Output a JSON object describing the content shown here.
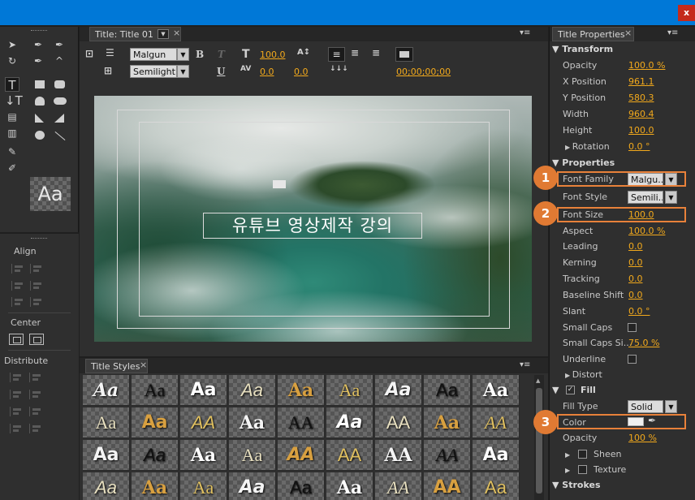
{
  "window": {
    "close_label": "x"
  },
  "title_panel": {
    "tab_label": "Title: Title 01",
    "font_family": "Malgun ...",
    "font_style": "Semilight",
    "bold_label": "B",
    "italic_label": "T",
    "underline_label": "U",
    "font_size": "100.0",
    "leading": "100.0",
    "kerning": "0.0",
    "tracking": "0.0",
    "timecode": "00;00;00;00",
    "canvas_text": "유튜브 영상제작 강의"
  },
  "styles_panel": {
    "tab_label": "Title Styles",
    "samples": [
      [
        "Aa",
        "Aa",
        "Aa",
        "Aa",
        "Aa",
        "Aa",
        "Aa",
        "Aa",
        "Aa"
      ],
      [
        "Aa",
        "Aa",
        "AA",
        "Aa",
        "AA",
        "Aa",
        "AA",
        "Aa",
        "AA"
      ],
      [
        "Aa",
        "Aa",
        "Aa",
        "Aa",
        "AA",
        "AA",
        "AA",
        "AA",
        "Aa"
      ],
      [
        "Aa",
        "Aa",
        "Aa",
        "Aa",
        "Aa",
        "Aa",
        "AA",
        "AA",
        "Aa"
      ]
    ]
  },
  "properties_panel": {
    "tab_label": "Title Properties",
    "transform_label": "Transform",
    "opacity": {
      "label": "Opacity",
      "value": "100.0 %"
    },
    "x_position": {
      "label": "X Position",
      "value": "961.1"
    },
    "y_position": {
      "label": "Y Position",
      "value": "580.3"
    },
    "width": {
      "label": "Width",
      "value": "960.4"
    },
    "height": {
      "label": "Height",
      "value": "100.0"
    },
    "rotation": {
      "label": "Rotation",
      "value": "0.0 °"
    },
    "properties_label": "Properties",
    "font_family": {
      "label": "Font Family",
      "value": "Malgu..."
    },
    "font_style": {
      "label": "Font Style",
      "value": "Semili..."
    },
    "font_size": {
      "label": "Font Size",
      "value": "100.0"
    },
    "aspect": {
      "label": "Aspect",
      "value": "100.0 %"
    },
    "leading": {
      "label": "Leading",
      "value": "0.0"
    },
    "kerning": {
      "label": "Kerning",
      "value": "0.0"
    },
    "tracking": {
      "label": "Tracking",
      "value": "0.0"
    },
    "baseline_shift": {
      "label": "Baseline Shift",
      "value": "0.0"
    },
    "slant": {
      "label": "Slant",
      "value": "0.0 °"
    },
    "small_caps": {
      "label": "Small Caps"
    },
    "small_caps_size": {
      "label": "Small Caps Si...",
      "value": "75.0 %"
    },
    "underline": {
      "label": "Underline"
    },
    "distort_label": "Distort",
    "fill_label": "Fill",
    "fill_type": {
      "label": "Fill Type",
      "value": "Solid"
    },
    "color": {
      "label": "Color",
      "swatch": "#f0f0f0"
    },
    "fill_opacity": {
      "label": "Opacity",
      "value": "100 %"
    },
    "sheen_label": "Sheen",
    "texture_label": "Texture",
    "strokes_label": "Strokes"
  },
  "align_panel": {
    "title": "Align",
    "center_label": "Center",
    "distribute_label": "Distribute"
  },
  "callouts": [
    "1",
    "2",
    "3"
  ],
  "colors": {
    "accent": "#f2a91c",
    "highlight": "#e8813a",
    "titlebar": "#0078d7"
  }
}
